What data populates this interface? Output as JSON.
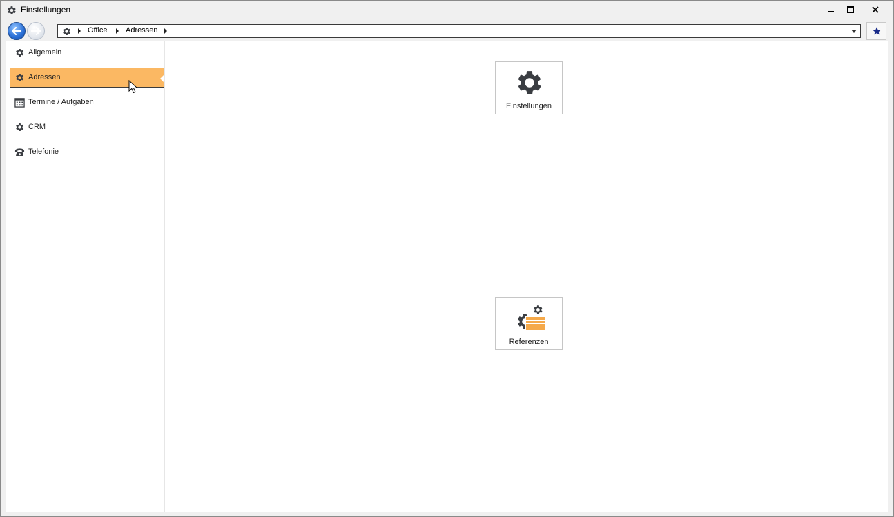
{
  "window": {
    "title": "Einstellungen",
    "title_icon": "gear-icon"
  },
  "navigation": {
    "back_icon": "arrow-left-icon",
    "forward_icon": "arrow-right-icon",
    "breadcrumb": [
      "Office",
      "Adressen"
    ],
    "favorite_icon": "star-icon"
  },
  "sidebar": {
    "items": [
      {
        "label": "Allgemein",
        "icon": "gear-icon",
        "active": false
      },
      {
        "label": "Adressen",
        "icon": "gear-icon",
        "active": true
      },
      {
        "label": "Termine / Aufgaben",
        "icon": "calendar-icon",
        "active": false
      },
      {
        "label": "CRM",
        "icon": "gear-icon",
        "active": false
      },
      {
        "label": "Telefonie",
        "icon": "phone-icon",
        "active": false
      }
    ]
  },
  "tiles": [
    {
      "label": "Einstellungen",
      "icon": "gear-icon"
    },
    {
      "label": "Referenzen",
      "icon": "gear-table-icon"
    }
  ],
  "colors": {
    "active_item": "#fbb863",
    "icon_dark": "#3a3d42",
    "table_orange": "#f5a94a",
    "star": "#1a2c8a"
  }
}
